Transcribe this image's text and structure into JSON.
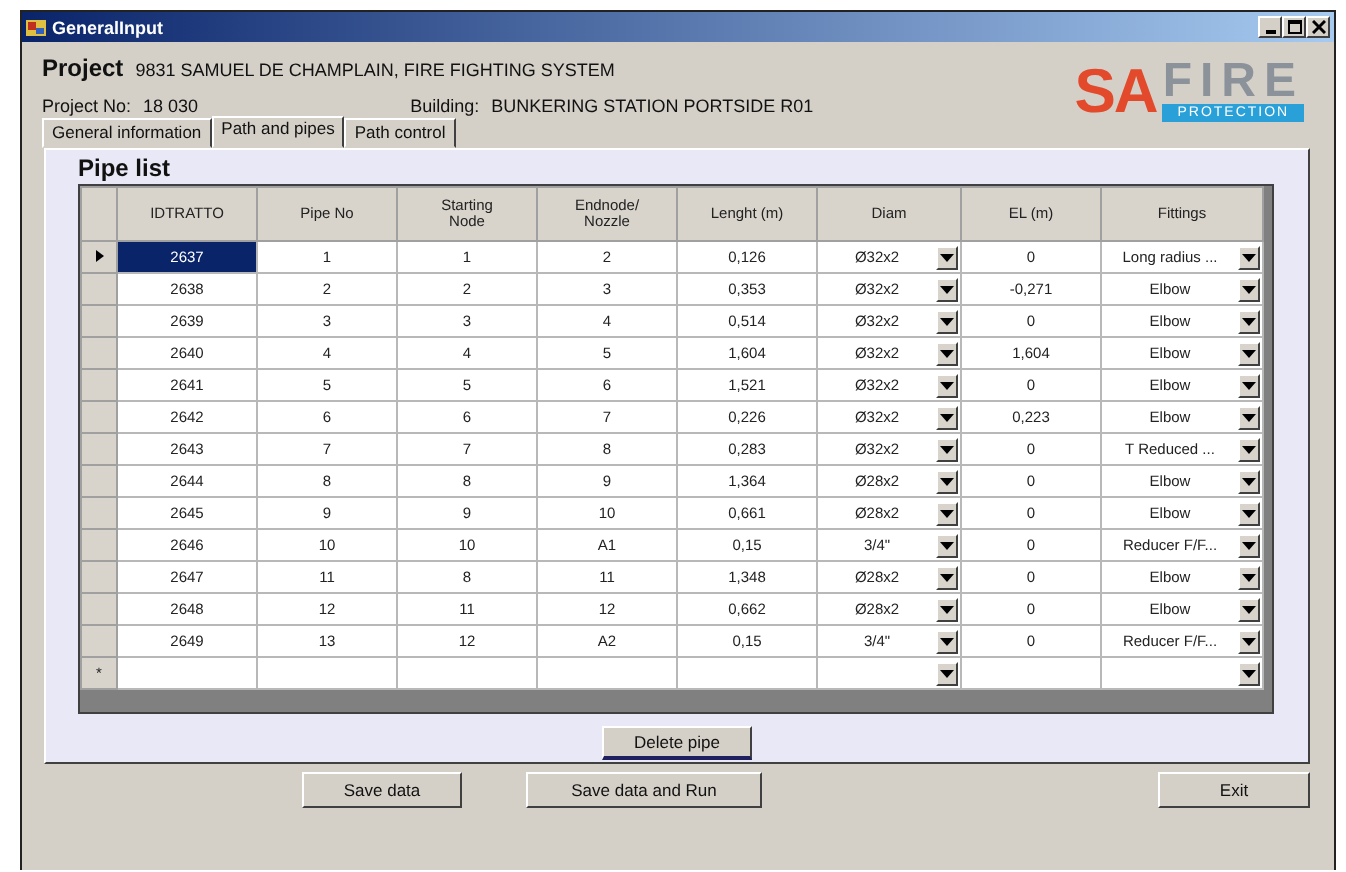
{
  "window": {
    "title": "GeneralInput"
  },
  "project": {
    "label": "Project",
    "value": "9831 SAMUEL DE CHAMPLAIN, FIRE FIGHTING SYSTEM",
    "number_label": "Project No:",
    "number": "18  030",
    "building_label": "Building:",
    "building": "BUNKERING STATION PORTSIDE R01"
  },
  "logo": {
    "primary": "SA",
    "secondary": "FIRE",
    "tagline": "PROTECTION"
  },
  "tabs": [
    {
      "label": "General information",
      "selected": false
    },
    {
      "label": "Path and pipes",
      "selected": true
    },
    {
      "label": "Path control",
      "selected": false
    }
  ],
  "panel_title": "Pipe list",
  "table": {
    "columns": [
      {
        "label": "IDTRATTO",
        "kind": "text"
      },
      {
        "label": "Pipe No",
        "kind": "text"
      },
      {
        "label": "Starting Node",
        "kind": "text"
      },
      {
        "label": "Endnode/ Nozzle",
        "kind": "text"
      },
      {
        "label": "Lenght (m)",
        "kind": "text"
      },
      {
        "label": "Diam",
        "kind": "combo"
      },
      {
        "label": "EL (m)",
        "kind": "text"
      },
      {
        "label": "Fittings",
        "kind": "combo"
      }
    ],
    "rows": [
      {
        "selected": true,
        "cells": [
          "2637",
          "1",
          "1",
          "2",
          "0,126",
          "Ø32x2",
          "0",
          "Long radius ..."
        ]
      },
      {
        "selected": false,
        "cells": [
          "2638",
          "2",
          "2",
          "3",
          "0,353",
          "Ø32x2",
          "-0,271",
          "Elbow"
        ]
      },
      {
        "selected": false,
        "cells": [
          "2639",
          "3",
          "3",
          "4",
          "0,514",
          "Ø32x2",
          "0",
          "Elbow"
        ]
      },
      {
        "selected": false,
        "cells": [
          "2640",
          "4",
          "4",
          "5",
          "1,604",
          "Ø32x2",
          "1,604",
          "Elbow"
        ]
      },
      {
        "selected": false,
        "cells": [
          "2641",
          "5",
          "5",
          "6",
          "1,521",
          "Ø32x2",
          "0",
          "Elbow"
        ]
      },
      {
        "selected": false,
        "cells": [
          "2642",
          "6",
          "6",
          "7",
          "0,226",
          "Ø32x2",
          "0,223",
          "Elbow"
        ]
      },
      {
        "selected": false,
        "cells": [
          "2643",
          "7",
          "7",
          "8",
          "0,283",
          "Ø32x2",
          "0",
          "T Reduced ..."
        ]
      },
      {
        "selected": false,
        "cells": [
          "2644",
          "8",
          "8",
          "9",
          "1,364",
          "Ø28x2",
          "0",
          "Elbow"
        ]
      },
      {
        "selected": false,
        "cells": [
          "2645",
          "9",
          "9",
          "10",
          "0,661",
          "Ø28x2",
          "0",
          "Elbow"
        ]
      },
      {
        "selected": false,
        "cells": [
          "2646",
          "10",
          "10",
          "A1",
          "0,15",
          "3/4\"",
          "0",
          "Reducer F/F..."
        ]
      },
      {
        "selected": false,
        "cells": [
          "2647",
          "11",
          "8",
          "11",
          "1,348",
          "Ø28x2",
          "0",
          "Elbow"
        ]
      },
      {
        "selected": false,
        "cells": [
          "2648",
          "12",
          "11",
          "12",
          "0,662",
          "Ø28x2",
          "0",
          "Elbow"
        ]
      },
      {
        "selected": false,
        "cells": [
          "2649",
          "13",
          "12",
          "A2",
          "0,15",
          "3/4\"",
          "0",
          "Reducer F/F..."
        ]
      }
    ],
    "new_row_marker": "*"
  },
  "delete_button": "Delete pipe",
  "buttons": [
    {
      "label": "Save data",
      "kind": "left"
    },
    {
      "label": "Save data and Run",
      "kind": "left"
    },
    {
      "label": "Exit",
      "kind": "right"
    }
  ]
}
